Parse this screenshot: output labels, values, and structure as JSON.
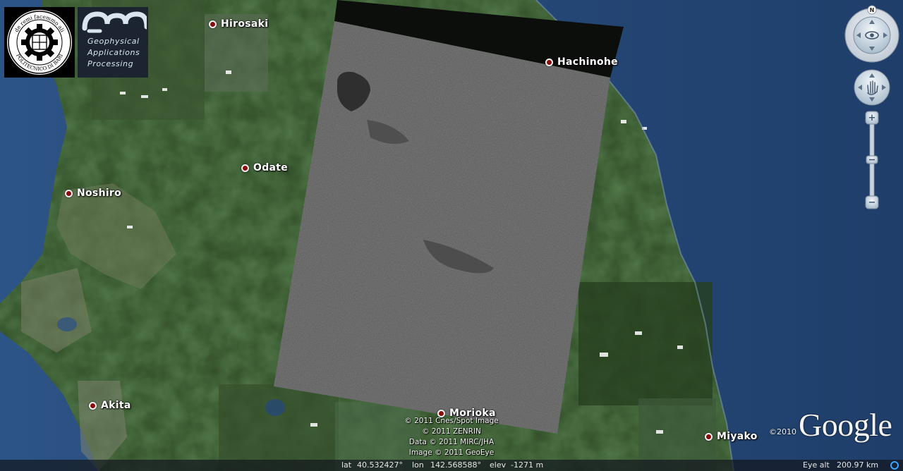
{
  "map": {
    "cities": [
      {
        "name": "Hirosaki"
      },
      {
        "name": "Hachinohe"
      },
      {
        "name": "Odate"
      },
      {
        "name": "Noshiro"
      },
      {
        "name": "Akita"
      },
      {
        "name": "Morioka"
      },
      {
        "name": "Miyako"
      }
    ]
  },
  "logos": {
    "poliba": {
      "top_text": "de remi facemmo ali",
      "bottom_text": "POLITECNICO DI BARI"
    },
    "gap": {
      "line1": "Geophysical",
      "line2": "Applications",
      "line3": "Processing"
    }
  },
  "copyright": {
    "lines": [
      "© 2011 Cnes/Spot Image",
      "© 2011 ZENRIN",
      "Data © 2011 MIRC/JHA",
      "Image © 2011 GeoEye"
    ]
  },
  "brand": {
    "year": "©2010",
    "logo": "Google"
  },
  "navigation": {
    "compass_label": "N",
    "look_icon": "eye-icon",
    "move_icon": "hand-icon",
    "zoom_in": "+",
    "zoom_out": "−"
  },
  "status": {
    "lat_label": "lat",
    "lat_value": "40.532427°",
    "lon_label": "lon",
    "lon_value": "142.568588°",
    "elev_label": "elev",
    "elev_value": "-1271 m",
    "eye_label": "Eye alt",
    "eye_value": "200.97 km"
  },
  "colors": {
    "ocean": "#2a4d7c",
    "land": "#2e4a26",
    "sar_image": "#5a5a5a",
    "city_marker": "#8b0c0c"
  }
}
